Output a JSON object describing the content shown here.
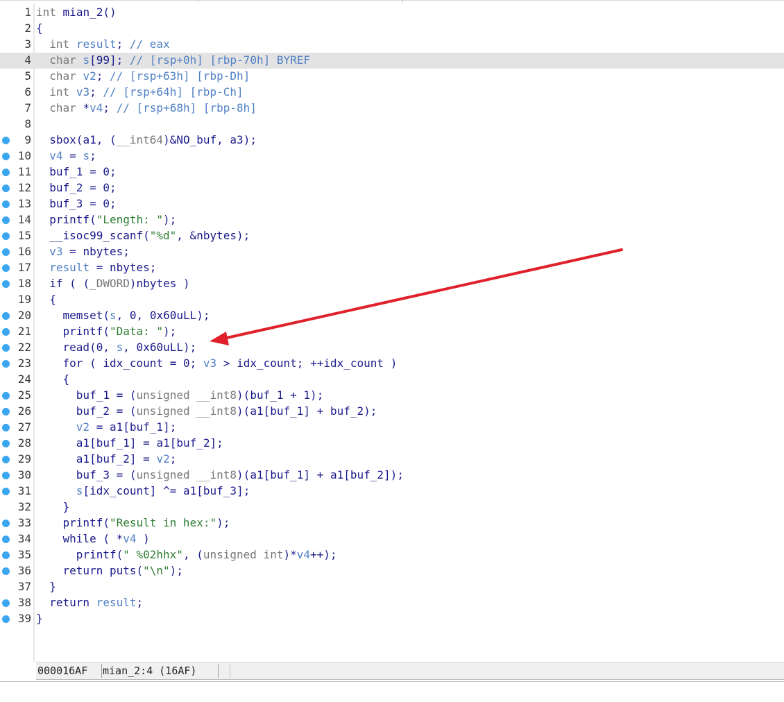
{
  "status_bar": {
    "address": "000016AF",
    "location": "mian_2:4 (16AF)"
  },
  "colors": {
    "breakpoint": "#3aa6f0",
    "highlight_row": "#e3e3e3",
    "arrow": "#e0212b",
    "match_highlight": "#f3f34a"
  },
  "annotation": "red-arrow pointing to line 22",
  "highlighted_line": 4,
  "lines": [
    {
      "n": "1",
      "bp": false,
      "text": "int mian_2()"
    },
    {
      "n": "2",
      "bp": false,
      "text": "{"
    },
    {
      "n": "3",
      "bp": false,
      "text": "  int result; // eax"
    },
    {
      "n": "4",
      "bp": false,
      "text": "  char s[99]; // [rsp+0h] [rbp-70h] BYREF"
    },
    {
      "n": "5",
      "bp": false,
      "text": "  char v2; // [rsp+63h] [rbp-Dh]"
    },
    {
      "n": "6",
      "bp": false,
      "text": "  int v3; // [rsp+64h] [rbp-Ch]"
    },
    {
      "n": "7",
      "bp": false,
      "text": "  char *v4; // [rsp+68h] [rbp-8h]"
    },
    {
      "n": "8",
      "bp": false,
      "text": ""
    },
    {
      "n": "9",
      "bp": true,
      "text": "  sbox(a1, (__int64)&NO_buf, a3);"
    },
    {
      "n": "10",
      "bp": true,
      "text": "  v4 = s;"
    },
    {
      "n": "11",
      "bp": true,
      "text": "  buf_1 = 0;"
    },
    {
      "n": "12",
      "bp": true,
      "text": "  buf_2 = 0;"
    },
    {
      "n": "13",
      "bp": true,
      "text": "  buf_3 = 0;"
    },
    {
      "n": "14",
      "bp": true,
      "text": "  printf(\"Length: \");"
    },
    {
      "n": "15",
      "bp": true,
      "text": "  __isoc99_scanf(\"%d\", &nbytes);"
    },
    {
      "n": "16",
      "bp": true,
      "text": "  v3 = nbytes;"
    },
    {
      "n": "17",
      "bp": true,
      "text": "  result = nbytes;"
    },
    {
      "n": "18",
      "bp": true,
      "text": "  if ( (_DWORD)nbytes )"
    },
    {
      "n": "19",
      "bp": false,
      "text": "  {"
    },
    {
      "n": "20",
      "bp": true,
      "text": "    memset(s, 0, 0x60uLL);"
    },
    {
      "n": "21",
      "bp": true,
      "text": "    printf(\"Data: \");"
    },
    {
      "n": "22",
      "bp": true,
      "text": "    read(0, s, 0x60uLL);"
    },
    {
      "n": "23",
      "bp": true,
      "text": "    for ( idx_count = 0; v3 > idx_count; ++idx_count )"
    },
    {
      "n": "24",
      "bp": false,
      "text": "    {"
    },
    {
      "n": "25",
      "bp": true,
      "text": "      buf_1 = (unsigned __int8)(buf_1 + 1);"
    },
    {
      "n": "26",
      "bp": true,
      "text": "      buf_2 = (unsigned __int8)(a1[buf_1] + buf_2);"
    },
    {
      "n": "27",
      "bp": true,
      "text": "      v2 = a1[buf_1];"
    },
    {
      "n": "28",
      "bp": true,
      "text": "      a1[buf_1] = a1[buf_2];"
    },
    {
      "n": "29",
      "bp": true,
      "text": "      a1[buf_2] = v2;"
    },
    {
      "n": "30",
      "bp": true,
      "text": "      buf_3 = (unsigned __int8)(a1[buf_1] + a1[buf_2]);"
    },
    {
      "n": "31",
      "bp": true,
      "text": "      s[idx_count] ^= a1[buf_3];"
    },
    {
      "n": "32",
      "bp": false,
      "text": "    }"
    },
    {
      "n": "33",
      "bp": true,
      "text": "    printf(\"Result in hex:\");"
    },
    {
      "n": "34",
      "bp": true,
      "text": "    while ( *v4 )"
    },
    {
      "n": "35",
      "bp": true,
      "text": "      printf(\" %02hhx\", (unsigned int)*v4++);"
    },
    {
      "n": "36",
      "bp": true,
      "text": "    return puts(\"\\n\");"
    },
    {
      "n": "37",
      "bp": false,
      "text": "  }"
    },
    {
      "n": "38",
      "bp": true,
      "text": "  return result;"
    },
    {
      "n": "39",
      "bp": true,
      "text": "}"
    }
  ]
}
